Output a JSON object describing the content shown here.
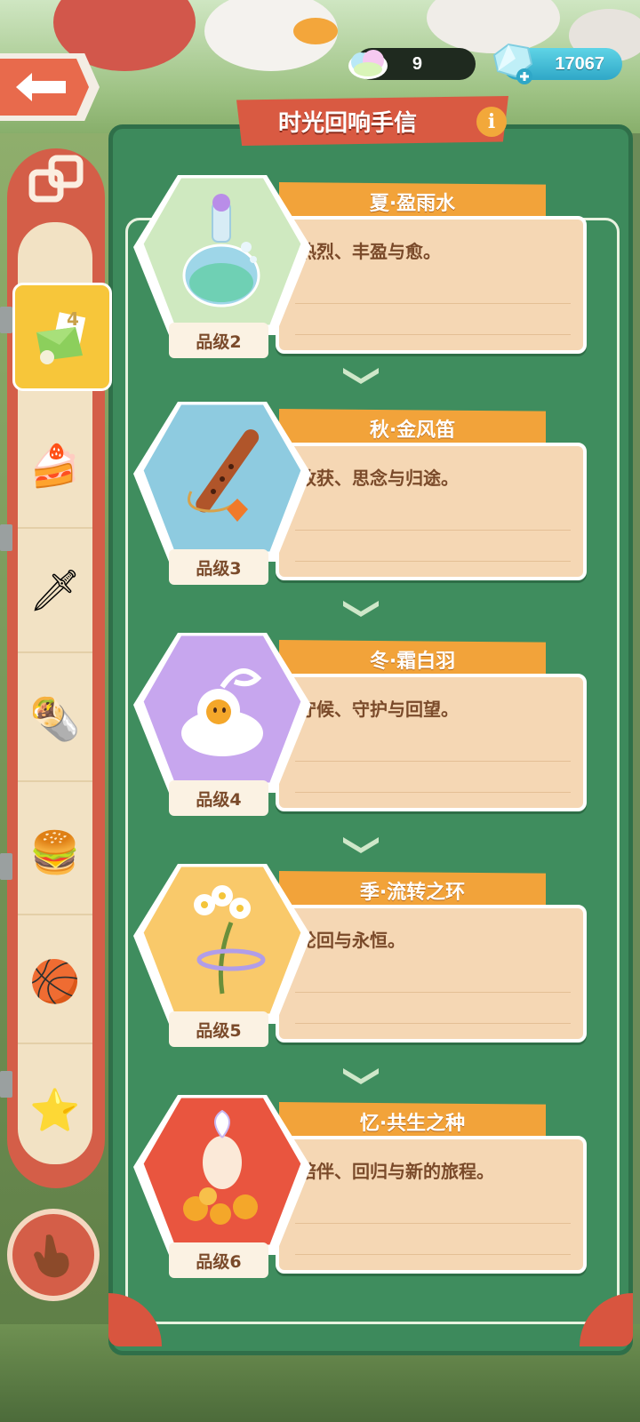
{
  "resources": {
    "cloud_count": "9",
    "gem_count": "17067"
  },
  "panel": {
    "title": "时光回响手信",
    "info_icon_glyph": "i"
  },
  "sidebar": {
    "active_badge": "4"
  },
  "cards": [
    {
      "title": "夏·盈雨水",
      "desc": "热烈、丰盈与愈。",
      "grade": "品级2",
      "item_icon": "potion-flask-icon",
      "bg_color": "#cfe9c0"
    },
    {
      "title": "秋·金风笛",
      "desc": "收获、思念与归途。",
      "grade": "品级3",
      "item_icon": "flute-icon",
      "bg_color": "#8ecbe0"
    },
    {
      "title": "冬·霜白羽",
      "desc": "守候、守护与回望。",
      "grade": "品级4",
      "item_icon": "white-feather-bird-icon",
      "bg_color": "#c7a6ee"
    },
    {
      "title": "季·流转之环",
      "desc": "轮回与永恒。",
      "grade": "品级5",
      "item_icon": "flower-ring-icon",
      "bg_color": "#f9c96a"
    },
    {
      "title": "忆·共生之种",
      "desc": "陪伴、回归与新的旅程。",
      "grade": "品级6",
      "item_icon": "seed-sprout-icon",
      "bg_color": "#e9553f"
    }
  ]
}
